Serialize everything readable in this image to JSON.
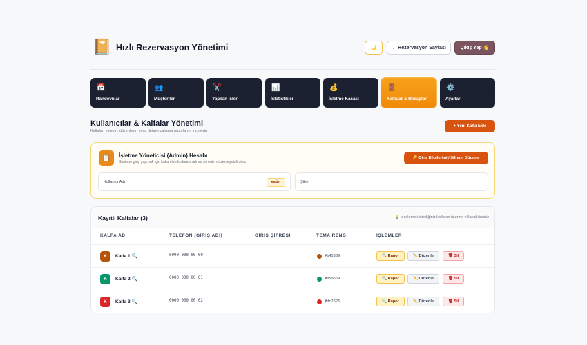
{
  "header": {
    "logo_icon": "📔",
    "title": "Hızlı Rezervasyon Yönetimi",
    "theme_icon": "🌙",
    "back_label": "← Rezervasyon Sayfası",
    "logout_label": "Çıkış Yap 👋"
  },
  "tabs": [
    {
      "icon": "📅",
      "label": "Randevular"
    },
    {
      "icon": "👥",
      "label": "Müşteriler"
    },
    {
      "icon": "✂️",
      "label": "Yapılan İşler"
    },
    {
      "icon": "📊",
      "label": "İstatistikler"
    },
    {
      "icon": "💰",
      "label": "İşletme Kasası"
    },
    {
      "icon": "🚪",
      "label": "Kalfalar & Hesaplar",
      "active": true
    },
    {
      "icon": "⚙️",
      "label": "Ayarlar"
    }
  ],
  "section": {
    "title": "Kullanıcılar & Kalfalar Yönetimi",
    "subtitle": "Kalfaları ekleyin, düzenleyin veya detaylı çalışma raporlarını inceleyin",
    "add_label": "+ Yeni Kalfa Ekle"
  },
  "admin": {
    "icon": "📋",
    "title": "İşletme Yöneticisi (Admin) Hesabı",
    "subtitle": "Sisteme giriş yapmak için kullanılan kullanıcı adı ve şifrenizi düzenleyebilirsiniz",
    "edit_label": "🔑 Giriş Bilgilerimi / Şifremi Düzenle",
    "username_label": "Kullanıcı Adı:",
    "username_value": "emir",
    "password_label": "Şifre:"
  },
  "list": {
    "title": "Kayıtlı Kalfalar (3)",
    "hint": "💡 İncelemek istediğiniz kalfanın üzerine tıklayabilirsiniz",
    "columns": [
      "KALFA ADI",
      "TELEFON (GİRİŞ ADI)",
      "GİRİŞ ŞİFRESİ",
      "TEMA RENGİ",
      "İŞLEMLER"
    ],
    "rows": [
      {
        "initial": "K",
        "name": "Kalfa 1 🔍",
        "phone": "0000 000 00 00",
        "color": "#b45309",
        "actions": {
          "report": "🔍 Rapor",
          "edit": "✏️ Düzenle",
          "delete": "🗑 Sil"
        }
      },
      {
        "initial": "K",
        "name": "Kalfa 2 🔍",
        "phone": "0000 000 00 01",
        "color": "#059669",
        "actions": {
          "report": "🔍 Rapor",
          "edit": "✏️ Düzenle",
          "delete": "🗑 Sil"
        }
      },
      {
        "initial": "K",
        "name": "Kalfa 3 🔍",
        "phone": "0000 000 00 02",
        "color": "#dc2626",
        "actions": {
          "report": "🔍 Rapor",
          "edit": "✏️ Düzenle",
          "delete": "🗑 Sil"
        }
      }
    ]
  }
}
